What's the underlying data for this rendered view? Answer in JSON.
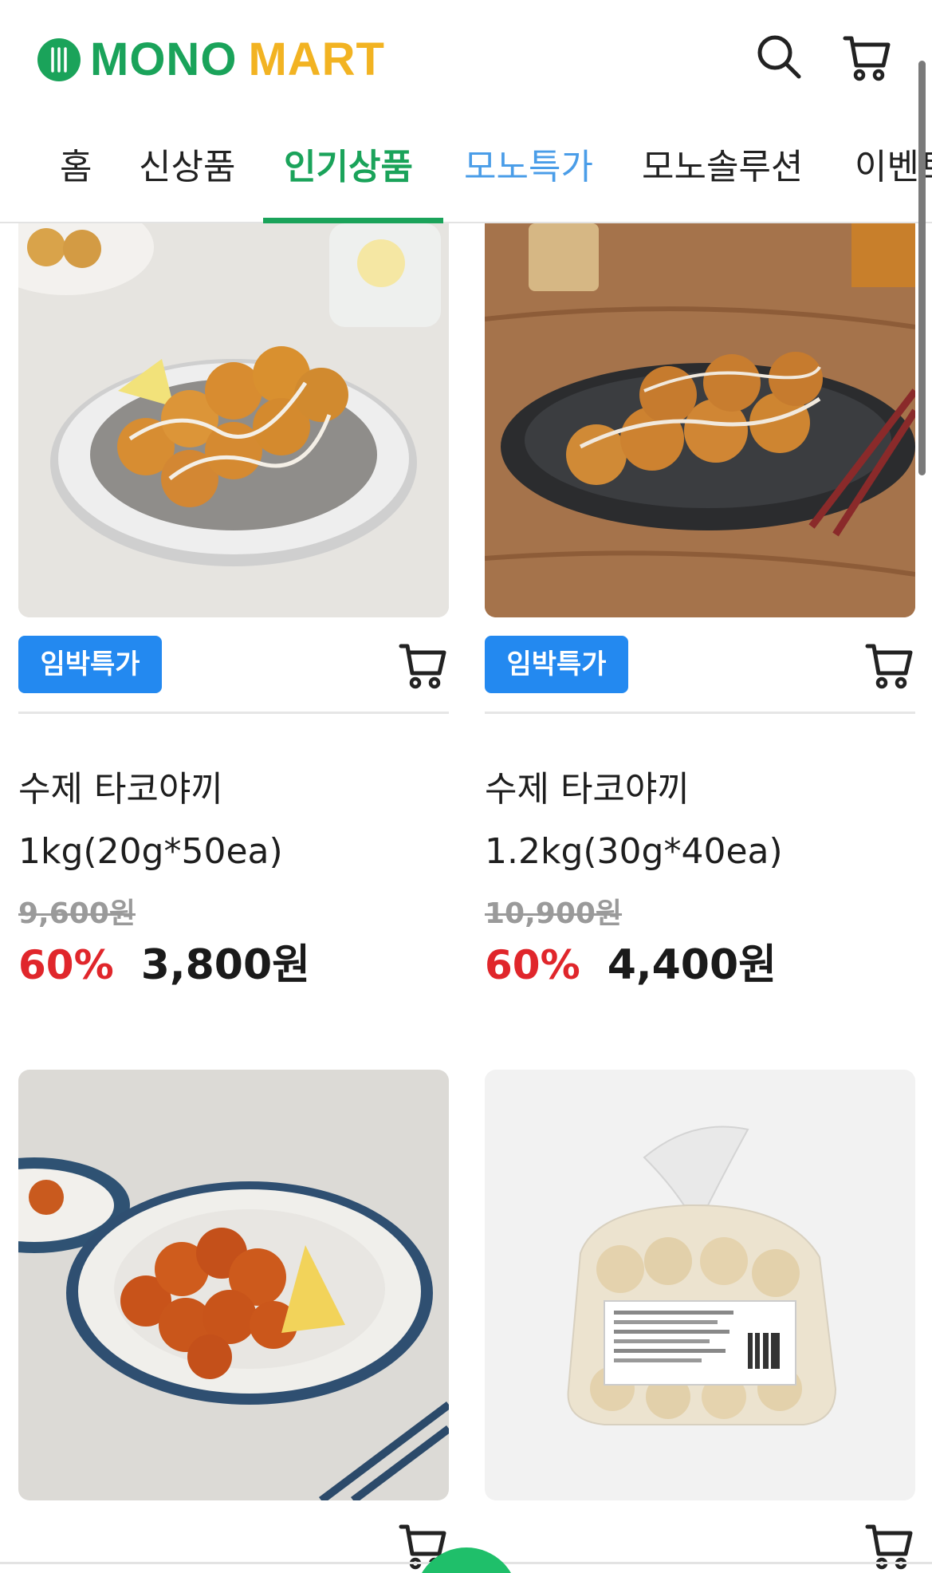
{
  "brand": {
    "name_1": "MONO",
    "name_2": "MART",
    "green": "#1aa35a",
    "yellow": "#f2b322"
  },
  "header": {
    "search_icon": "search-icon",
    "cart_icon": "cart-icon"
  },
  "tabs": [
    {
      "label": "홈"
    },
    {
      "label": "신상품"
    },
    {
      "label": "인기상품",
      "active": true
    },
    {
      "label": "모노특가"
    },
    {
      "label": "모노솔루션"
    },
    {
      "label": "이벤트"
    }
  ],
  "products": [
    {
      "badge": "임박특가",
      "name": "수제 타코야끼",
      "spec": "1kg(20g*50ea)",
      "original_price": "9,600원",
      "discount": "60%",
      "price": "3,800원"
    },
    {
      "badge": "임박특가",
      "name": "수제 타코야끼",
      "spec": "1.2kg(30g*40ea)",
      "original_price": "10,900원",
      "discount": "60%",
      "price": "4,400원"
    },
    {
      "image": "fried chicken on plate"
    },
    {
      "image": "frozen product bag"
    }
  ],
  "colors": {
    "badge": "#2389f0",
    "discount": "#e0262b",
    "accent": "#1aa35a"
  }
}
